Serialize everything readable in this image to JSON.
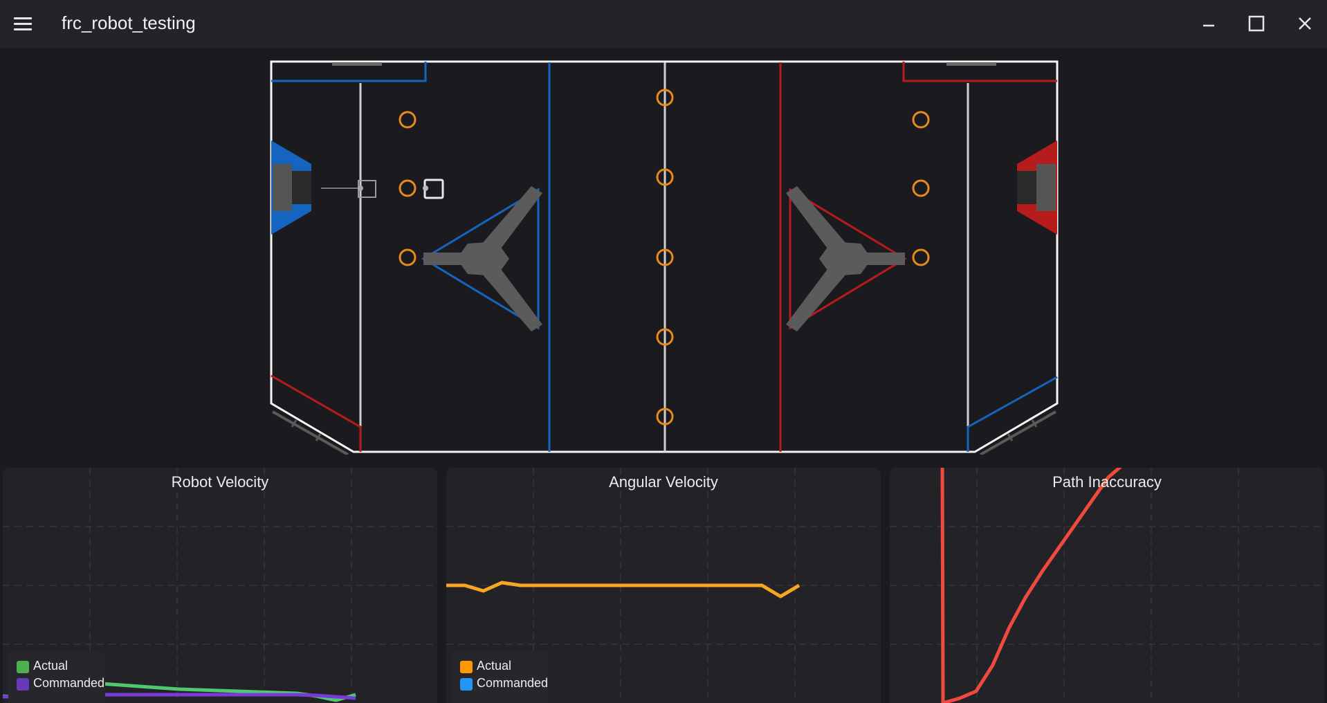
{
  "app": {
    "title": "frc_robot_testing"
  },
  "colors": {
    "blue_alliance": "#1565c0",
    "red_alliance": "#b71c1c",
    "game_piece": "#e88b1a",
    "actual_velocity": "#4fc86e",
    "commanded_velocity": "#7a3ad6",
    "angular_actual": "#f5a623",
    "angular_commanded": "#2196f3",
    "path_error": "#f04a3e"
  },
  "field": {
    "blue_alliance_color": "blue",
    "red_alliance_color": "red",
    "game_piece_icon": "orange-ring-icon"
  },
  "charts": [
    {
      "title": "Robot Velocity",
      "legend": [
        {
          "label": "Actual",
          "color": "#4caf50"
        },
        {
          "label": "Commanded",
          "color": "#673ab7"
        }
      ]
    },
    {
      "title": "Angular Velocity",
      "legend": [
        {
          "label": "Actual",
          "color": "#ff9800"
        },
        {
          "label": "Commanded",
          "color": "#2196f3"
        }
      ]
    },
    {
      "title": "Path Inaccuracy",
      "legend": []
    }
  ],
  "chart_data": [
    {
      "type": "line",
      "title": "Robot Velocity",
      "grid": true,
      "legend_position": "bottom-left",
      "series": [
        {
          "name": "Actual",
          "values": [
            0.06,
            0.04,
            0.08,
            0.22,
            0.26,
            0.24,
            0.22,
            0.2,
            0.18,
            0.16,
            0.15,
            0.14,
            0.13,
            0.12,
            0.11,
            0.1,
            0.06,
            0.0,
            0.08
          ]
        },
        {
          "name": "Commanded",
          "values": [
            0.05,
            0.06,
            0.08,
            0.08,
            0.08,
            0.08,
            0.08,
            0.08,
            0.08,
            0.08,
            0.08,
            0.08,
            0.08,
            0.08,
            0.08,
            0.08,
            0.07,
            0.05,
            0.03
          ]
        }
      ]
    },
    {
      "type": "line",
      "title": "Angular Velocity",
      "grid": true,
      "legend_position": "bottom-left",
      "series": [
        {
          "name": "Actual",
          "values": [
            0.0,
            0.0,
            -0.02,
            0.01,
            0.0,
            0.0,
            0.0,
            0.0,
            0.0,
            0.0,
            0.0,
            0.0,
            0.0,
            0.0,
            0.0,
            0.0,
            0.0,
            0.0,
            -0.04,
            0.0
          ]
        }
      ]
    },
    {
      "type": "line",
      "title": "Path Inaccuracy",
      "grid": true,
      "series": [
        {
          "name": "",
          "values": [
            1.0,
            0.0,
            0.02,
            0.05,
            0.16,
            0.32,
            0.45,
            0.56,
            0.66,
            0.76,
            0.86,
            0.96,
            1.02
          ]
        }
      ]
    }
  ]
}
